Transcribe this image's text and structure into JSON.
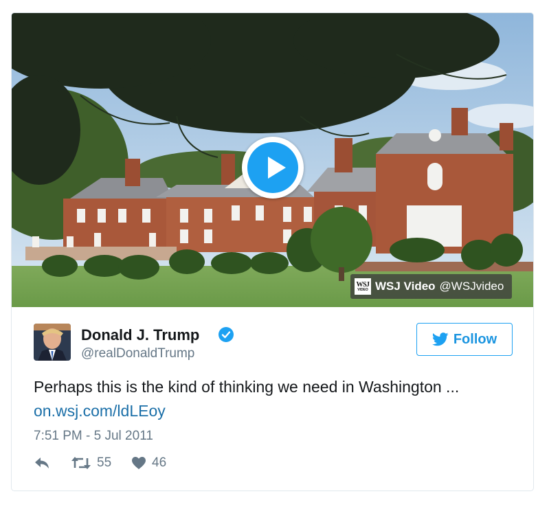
{
  "media": {
    "attribution": {
      "logo_text": "WSJ",
      "logo_subtext": "VIDEO",
      "name": "WSJ Video",
      "handle": "@WSJvideo"
    }
  },
  "author": {
    "name": "Donald J. Trump",
    "handle": "@realDonaldTrump",
    "verified": true
  },
  "follow_button": {
    "label": "Follow"
  },
  "tweet": {
    "text": "Perhaps this is the kind of thinking we need in Washington ...",
    "link": "on.wsj.com/ldLEoy",
    "timestamp": "7:51 PM - 5 Jul 2011"
  },
  "actions": {
    "reply_icon": "reply-icon",
    "retweet_icon": "retweet-icon",
    "retweet_count": "55",
    "like_icon": "heart-icon",
    "like_count": "46"
  },
  "colors": {
    "accent": "#1da1f2",
    "link": "#1b6fa8",
    "muted": "#657786",
    "text": "#14171a",
    "border": "#e1e8ed"
  }
}
